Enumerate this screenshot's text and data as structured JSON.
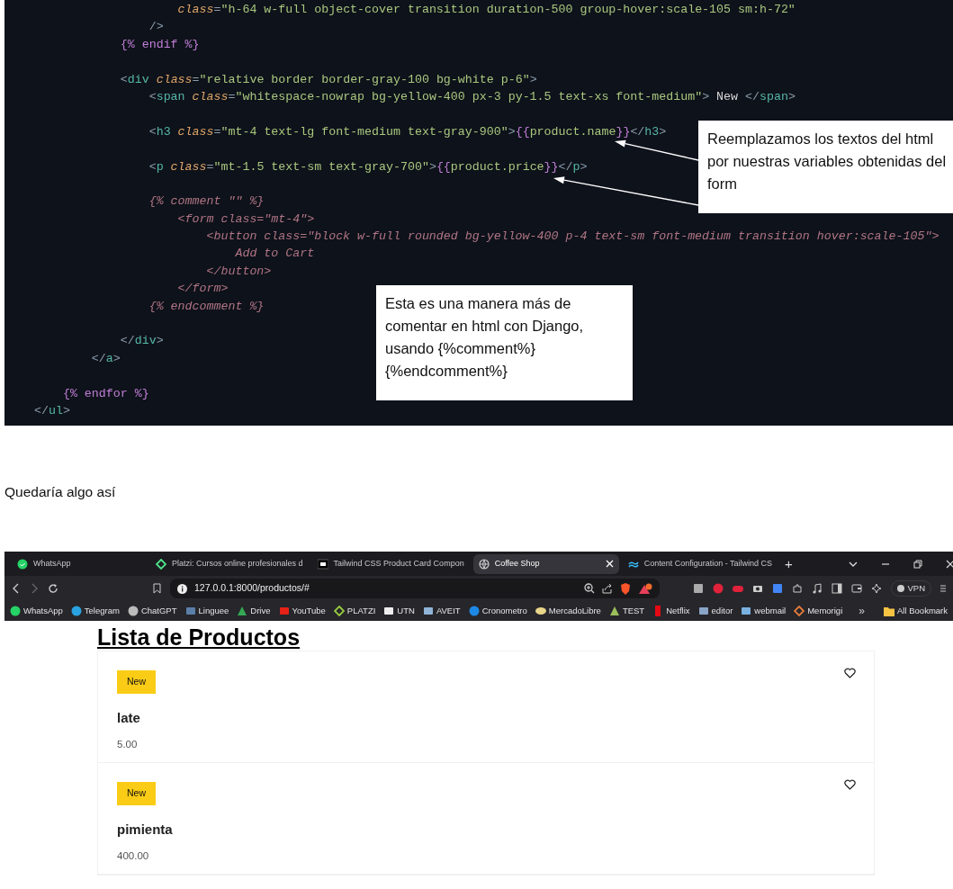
{
  "code_editor": {
    "lines": [
      {
        "kind": "code",
        "tokens": [
          {
            "kind": "attr",
            "text": "                    class"
          },
          {
            "kind": "punct",
            "text": "="
          },
          {
            "kind": "str",
            "text": "\"h-64 w-full object-cover transition duration-500 group-hover:scale-105 sm:h-72\""
          }
        ]
      },
      {
        "kind": "code",
        "tokens": [
          {
            "kind": "punct",
            "text": "                />"
          }
        ]
      },
      {
        "kind": "code",
        "tokens": [
          {
            "kind": "tpl",
            "text": "            {% endif %}"
          }
        ]
      },
      {
        "kind": "blank"
      },
      {
        "kind": "code",
        "tokens": [
          {
            "kind": "punct",
            "text": "            <"
          },
          {
            "kind": "tag",
            "text": "div"
          },
          {
            "kind": "attr",
            "text": " class"
          },
          {
            "kind": "punct",
            "text": "="
          },
          {
            "kind": "str",
            "text": "\"relative border border-gray-100 bg-white p-6\""
          },
          {
            "kind": "punct",
            "text": ">"
          }
        ]
      },
      {
        "kind": "code",
        "tokens": [
          {
            "kind": "punct",
            "text": "                <"
          },
          {
            "kind": "tag",
            "text": "span"
          },
          {
            "kind": "attr",
            "text": " class"
          },
          {
            "kind": "punct",
            "text": "="
          },
          {
            "kind": "str",
            "text": "\"whitespace-nowrap bg-yellow-400 px-3 py-1.5 text-xs font-medium\""
          },
          {
            "kind": "punct",
            "text": ">"
          },
          {
            "kind": "plain",
            "text": " New "
          },
          {
            "kind": "punct",
            "text": "</"
          },
          {
            "kind": "tag",
            "text": "span"
          },
          {
            "kind": "punct",
            "text": ">"
          }
        ]
      },
      {
        "kind": "blank"
      },
      {
        "kind": "code",
        "tokens": [
          {
            "kind": "punct",
            "text": "                <"
          },
          {
            "kind": "tag",
            "text": "h3"
          },
          {
            "kind": "attr",
            "text": " class"
          },
          {
            "kind": "punct",
            "text": "="
          },
          {
            "kind": "str",
            "text": "\"mt-4 text-lg font-medium text-gray-900\""
          },
          {
            "kind": "punct",
            "text": ">"
          },
          {
            "kind": "tpl",
            "text": "{{"
          },
          {
            "kind": "str",
            "text": "product.name"
          },
          {
            "kind": "tpl",
            "text": "}}"
          },
          {
            "kind": "punct",
            "text": "</"
          },
          {
            "kind": "tag",
            "text": "h3"
          },
          {
            "kind": "punct",
            "text": ">"
          }
        ]
      },
      {
        "kind": "blank"
      },
      {
        "kind": "code",
        "tokens": [
          {
            "kind": "punct",
            "text": "                <"
          },
          {
            "kind": "tag",
            "text": "p"
          },
          {
            "kind": "attr",
            "text": " class"
          },
          {
            "kind": "punct",
            "text": "="
          },
          {
            "kind": "str",
            "text": "\"mt-1.5 text-sm text-gray-700\""
          },
          {
            "kind": "punct",
            "text": ">"
          },
          {
            "kind": "tpl",
            "text": "{{"
          },
          {
            "kind": "str",
            "text": "product.price"
          },
          {
            "kind": "tpl",
            "text": "}}"
          },
          {
            "kind": "punct",
            "text": "</"
          },
          {
            "kind": "tag",
            "text": "p"
          },
          {
            "kind": "punct",
            "text": ">"
          }
        ]
      },
      {
        "kind": "blank"
      },
      {
        "kind": "code",
        "tokens": [
          {
            "kind": "cmt",
            "text": "                {% comment \"\" %}"
          }
        ]
      },
      {
        "kind": "code",
        "tokens": [
          {
            "kind": "cmt",
            "text": "                    <form class=\"mt-4\">"
          }
        ]
      },
      {
        "kind": "code",
        "tokens": [
          {
            "kind": "cmt",
            "text": "                        <button class=\"block w-full rounded bg-yellow-400 p-4 text-sm font-medium transition hover:scale-105\">"
          }
        ]
      },
      {
        "kind": "code",
        "tokens": [
          {
            "kind": "cmt",
            "text": "                            Add to Cart"
          }
        ]
      },
      {
        "kind": "code",
        "tokens": [
          {
            "kind": "cmt",
            "text": "                        </button>"
          }
        ]
      },
      {
        "kind": "code",
        "tokens": [
          {
            "kind": "cmt",
            "text": "                    </form>"
          }
        ]
      },
      {
        "kind": "code",
        "tokens": [
          {
            "kind": "cmt",
            "text": "                {% endcomment %}"
          }
        ]
      },
      {
        "kind": "blank"
      },
      {
        "kind": "code",
        "tokens": [
          {
            "kind": "punct",
            "text": "            </"
          },
          {
            "kind": "tag",
            "text": "div"
          },
          {
            "kind": "punct",
            "text": ">"
          }
        ]
      },
      {
        "kind": "code",
        "tokens": [
          {
            "kind": "punct",
            "text": "        </"
          },
          {
            "kind": "tag",
            "text": "a"
          },
          {
            "kind": "punct",
            "text": ">"
          }
        ]
      },
      {
        "kind": "blank"
      },
      {
        "kind": "code",
        "tokens": [
          {
            "kind": "tpl",
            "text": "    {% endfor %}"
          }
        ]
      },
      {
        "kind": "code",
        "tokens": [
          {
            "kind": "punct",
            "text": "</"
          },
          {
            "kind": "tag",
            "text": "ul"
          },
          {
            "kind": "punct",
            "text": ">"
          }
        ]
      }
    ]
  },
  "callouts": [
    {
      "text": "Reemplazamos los textos del html por nuestras variables obtenidas del form"
    },
    {
      "text": "Esta es una manera más de comentar en html con Django, usando {%comment%}{%endcomment%}"
    }
  ],
  "paragraph": "Quedaría algo así",
  "browser": {
    "tabs": [
      {
        "title": "WhatsApp",
        "selected": false
      },
      {
        "title": "Platzi: Cursos online profesionales d",
        "selected": false
      },
      {
        "title": "Tailwind CSS Product Card Compon",
        "selected": false
      },
      {
        "title": "Coffee Shop",
        "selected": true
      },
      {
        "title": "Content Configuration - Tailwind CS",
        "selected": false
      }
    ],
    "new_tab": "+",
    "address": "127.0.0.1:8000/productos/#",
    "vpn": "VPN",
    "bookmarks": [
      {
        "label": "WhatsApp"
      },
      {
        "label": "Telegram"
      },
      {
        "label": "ChatGPT"
      },
      {
        "label": "Linguee"
      },
      {
        "label": "Drive"
      },
      {
        "label": "YouTube"
      },
      {
        "label": "PLATZI"
      },
      {
        "label": "UTN"
      },
      {
        "label": "AVEIT"
      },
      {
        "label": "Cronometro"
      },
      {
        "label": "MercadoLibre"
      },
      {
        "label": "TEST"
      },
      {
        "label": "Netflix"
      },
      {
        "label": "editor"
      },
      {
        "label": "webmail"
      },
      {
        "label": "Memorigi"
      }
    ],
    "more": "»",
    "all_bookmarks": "All Bookmark",
    "page": {
      "heading": "Lista de Productos",
      "products": [
        {
          "badge": "New",
          "name": "late",
          "price": "5.00"
        },
        {
          "badge": "New",
          "name": "pimienta",
          "price": "400.00"
        }
      ]
    }
  }
}
